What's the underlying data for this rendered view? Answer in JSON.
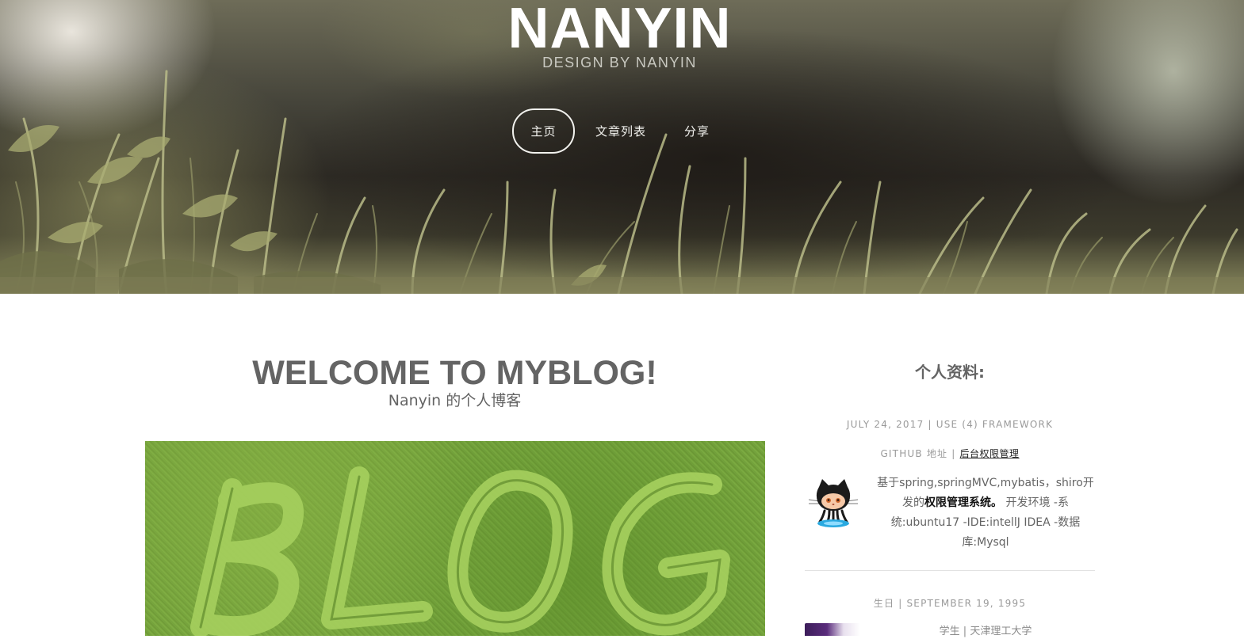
{
  "header": {
    "title": "NANYIN",
    "subtitle": "DESIGN BY NANYIN"
  },
  "nav": {
    "items": [
      {
        "label": "主页",
        "active": true
      },
      {
        "label": "文章列表",
        "active": false
      },
      {
        "label": "分享",
        "active": false
      }
    ]
  },
  "main": {
    "title": "WELCOME TO MYBLOG!",
    "subtitle": "Nanyin 的个人博客",
    "feature_image_text": "BLOG"
  },
  "sidebar": {
    "title": "个人资料:",
    "post_meta": "JULY 24, 2017 | USE (4) FRAMEWORK",
    "github_label": "GITHUB 地址 |",
    "github_link": "后台权限管理",
    "description_prefix": "基于spring,springMVC,mybatis，shiro开发的",
    "description_bold": "权限管理系统。",
    "description_suffix": " 开发环境 -系统:ubuntu17 -IDE:intellJ IDEA -数据库:Mysql",
    "birthday": "生日 | SEPTEMBER 19, 1995",
    "bio": "学生  |  天津理工大学"
  },
  "colors": {
    "text_gray": "#646464",
    "meta_gray": "#9a9a9a",
    "link": "#222222",
    "nav_text": "#f2f2ee"
  },
  "icons": {
    "github_avatar": "github-octocat-icon"
  }
}
